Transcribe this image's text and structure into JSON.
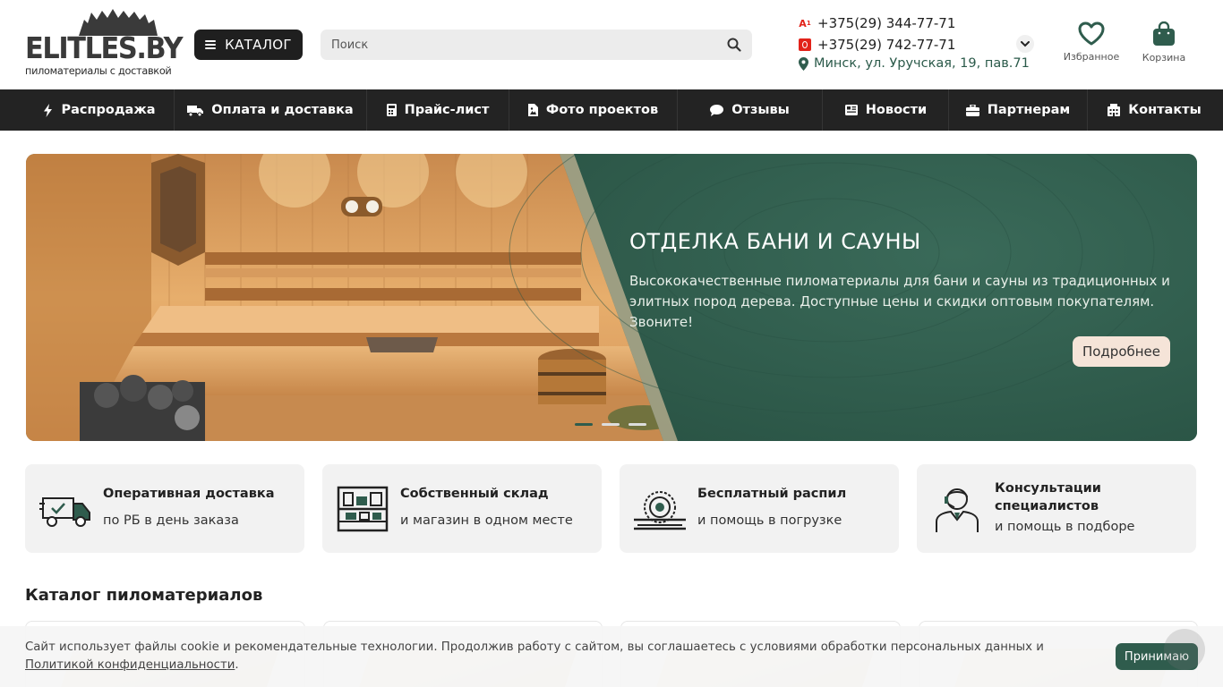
{
  "header": {
    "logo_text": "ELITLES.BY",
    "logo_subtitle": "пиломатериалы с доставкой",
    "catalog_label": "КАТАЛОГ",
    "search_placeholder": "Поиск",
    "phones": [
      {
        "operator": "a1-icon",
        "number": "+375(29) 344-77-71"
      },
      {
        "operator": "mts-icon",
        "number": "+375(29) 742-77-71"
      }
    ],
    "address": "Минск, ул. Уручская, 19, пав.71",
    "favorites_label": "Избранное",
    "cart_label": "Корзина"
  },
  "nav": {
    "items": [
      {
        "label": "Распродажа",
        "icon": "bolt-icon"
      },
      {
        "label": "Оплата и доставка",
        "icon": "truck-icon"
      },
      {
        "label": "Прайс-лист",
        "icon": "calculator-icon"
      },
      {
        "label": "Фото проектов",
        "icon": "file-image-icon"
      },
      {
        "label": "Отзывы",
        "icon": "comment-icon"
      },
      {
        "label": "Новости",
        "icon": "newspaper-icon"
      },
      {
        "label": "Партнерам",
        "icon": "briefcase-icon"
      },
      {
        "label": "Контакты",
        "icon": "building-icon"
      }
    ]
  },
  "banner": {
    "title": "ОТДЕЛКА БАНИ И САУНЫ",
    "text": "Высококачественные пиломатериалы для бани и сауны из традиционных и элитных пород дерева. Доступные цены и скидки оптовым покупателям. Звоните!",
    "button_label": "Подробнее",
    "slides_total": 3,
    "active_slide": 1
  },
  "features": [
    {
      "title": "Оперативная доставка",
      "subtitle": "по РБ в день заказа",
      "icon": "delivery-truck-icon"
    },
    {
      "title": "Собственный склад",
      "subtitle": "и магазин в одном месте",
      "icon": "warehouse-shelf-icon"
    },
    {
      "title": "Бесплатный распил",
      "subtitle": "и помощь в погрузке",
      "icon": "circular-saw-icon"
    },
    {
      "title": "Консультации специалистов",
      "subtitle": "и помощь в подборе",
      "icon": "consultant-headset-icon"
    }
  ],
  "catalog": {
    "title": "Каталог пиломатериалов"
  },
  "cookie": {
    "text": "Сайт использует файлы cookie и рекомендательные технологии. Продолжив работу с сайтом, вы соглашаетесь с условиями обработки персональных данных и ",
    "link": "Политикой конфиденциальности",
    "tail": ".",
    "accept_label": "Принимаю"
  },
  "colors": {
    "brand_green": "#2f5c4d",
    "nav_bg": "#232323",
    "accept_button": "#2f5c4d"
  }
}
